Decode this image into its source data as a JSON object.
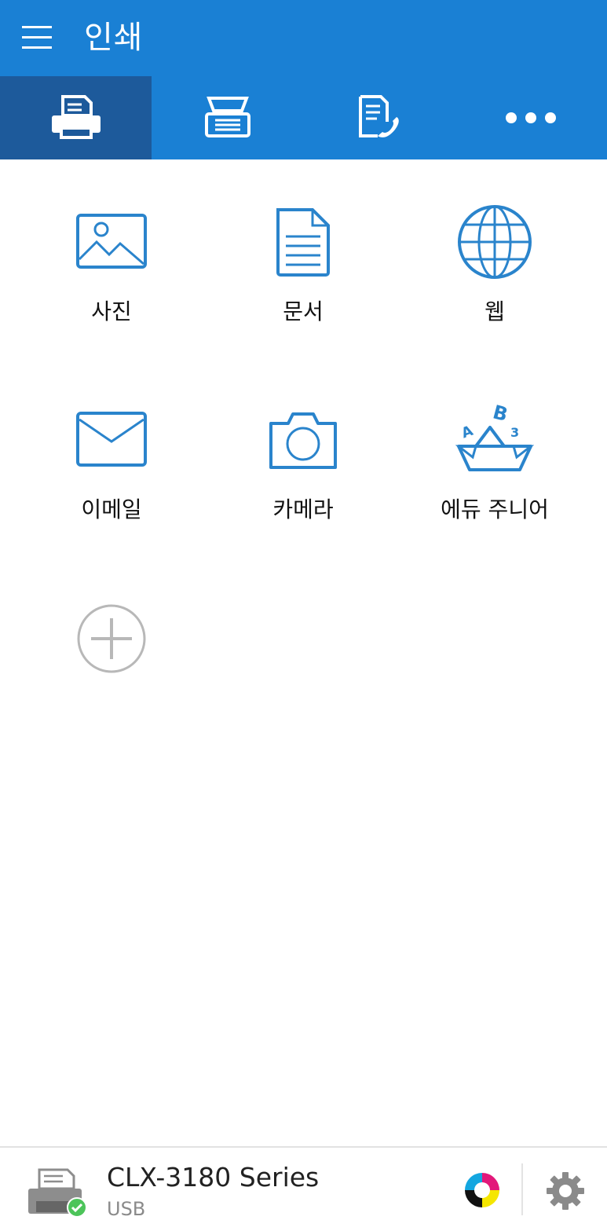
{
  "appbar": {
    "title": "인쇄",
    "menu_icon": "hamburger-menu-icon"
  },
  "tabs": [
    {
      "icon": "print-icon",
      "active": true
    },
    {
      "icon": "scan-icon",
      "active": false
    },
    {
      "icon": "fax-icon",
      "active": false
    },
    {
      "icon": "more-dots-icon",
      "active": false
    }
  ],
  "grid": [
    {
      "label": "사진",
      "icon": "photo-icon"
    },
    {
      "label": "문서",
      "icon": "document-icon"
    },
    {
      "label": "웹",
      "icon": "globe-icon"
    },
    {
      "label": "이메일",
      "icon": "email-icon"
    },
    {
      "label": "카메라",
      "icon": "camera-icon"
    },
    {
      "label": "에듀 주니어",
      "icon": "edu-junior-boat-icon"
    }
  ],
  "add_icon": "add-circle-icon",
  "footer": {
    "printer_name": "CLX-3180 Series",
    "connection": "USB",
    "status_icon": "connected-check-icon",
    "ink_icon": "ink-level-icon",
    "settings_icon": "gear-icon"
  },
  "colors": {
    "primary": "#1a80d4",
    "active_tab": "#1d5a9b",
    "icon_blue": "#2a84cc",
    "ok_green": "#4cc45a"
  }
}
